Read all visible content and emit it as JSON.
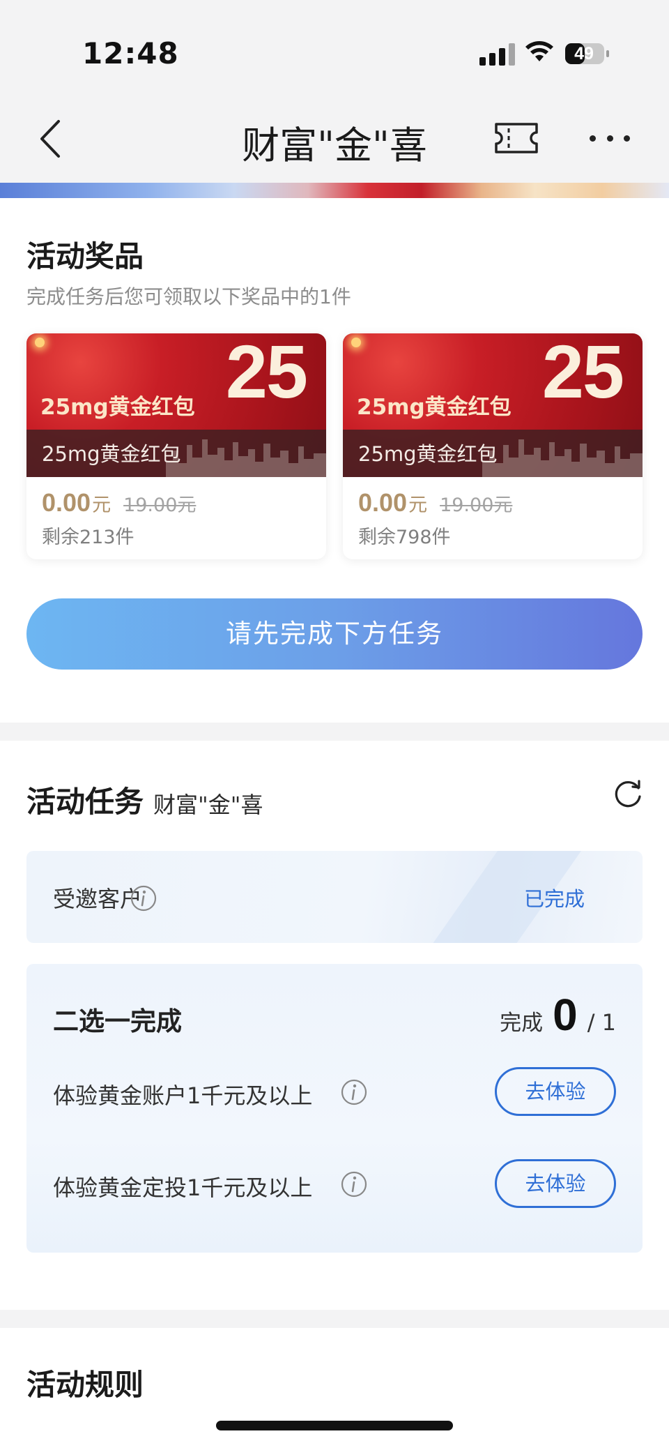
{
  "status_bar": {
    "time": "12:48",
    "battery": "49"
  },
  "nav": {
    "title": "财富\"金\"喜"
  },
  "prizes": {
    "title": "活动奖品",
    "subtitle": "完成任务后您可领取以下奖品中的1件",
    "items": [
      {
        "big_number": "25",
        "image_label": "25mg黄金红包",
        "name": "25mg黄金红包",
        "price": "0.00",
        "unit": "元",
        "original_price": "19.00元",
        "remaining": "剩余213件"
      },
      {
        "big_number": "25",
        "image_label": "25mg黄金红包",
        "name": "25mg黄金红包",
        "price": "0.00",
        "unit": "元",
        "original_price": "19.00元",
        "remaining": "剩余798件"
      }
    ],
    "cta_label": "请先完成下方任务"
  },
  "tasks": {
    "title": "活动任务",
    "subtitle": "财富\"金\"喜",
    "invited": {
      "label": "受邀客户",
      "status": "已完成"
    },
    "choose_one": {
      "title": "二选一完成",
      "progress_label": "完成",
      "progress_done": "0",
      "progress_total": "/ 1",
      "items": [
        {
          "label": "体验黄金账户1千元及以上",
          "button": "去体验"
        },
        {
          "label": "体验黄金定投1千元及以上",
          "button": "去体验"
        }
      ]
    }
  },
  "rules": {
    "title": "活动规则"
  },
  "colors": {
    "accent_blue": "#2f6fd6",
    "price_gold": "#b0926a",
    "prize_red": "#c81e26"
  }
}
